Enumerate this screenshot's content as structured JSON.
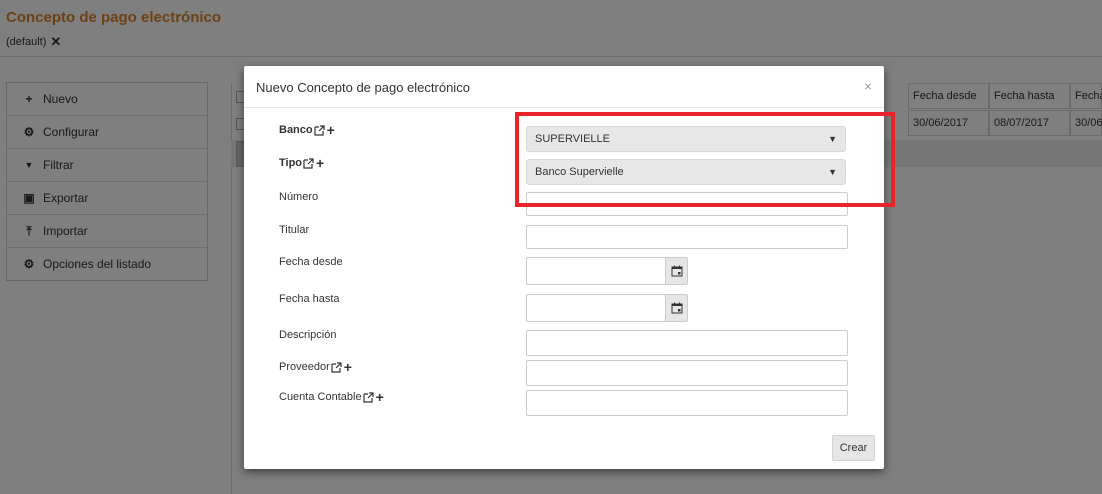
{
  "page": {
    "title": "Concepto de pago electrónico",
    "view_tab": "(default)",
    "view_tab_close": "✕"
  },
  "sidebar": {
    "items": [
      {
        "icon": "plus-icon",
        "glyph": "+",
        "label": "Nuevo"
      },
      {
        "icon": "gear-icon",
        "glyph": "⚙",
        "label": "Configurar"
      },
      {
        "icon": "filter-icon",
        "glyph": "▼",
        "label": "Filtrar"
      },
      {
        "icon": "excel-icon",
        "glyph": "▣",
        "label": "Exportar"
      },
      {
        "icon": "upload-icon",
        "glyph": "⤒",
        "label": "Importar"
      },
      {
        "icon": "gear-icon",
        "glyph": "⚙",
        "label": "Opciones del listado"
      }
    ]
  },
  "background_table": {
    "headers": [
      "Fecha desde",
      "Fecha hasta",
      "Fecha"
    ],
    "row": [
      "30/06/2017",
      "08/07/2017",
      "30/06"
    ]
  },
  "modal": {
    "title": "Nuevo Concepto de pago electrónico",
    "close": "×",
    "fields": {
      "banco": {
        "label": "Banco",
        "value": "SUPERVIELLE"
      },
      "tipo": {
        "label": "Tipo",
        "value": "Banco Supervielle"
      },
      "numero": {
        "label": "Número",
        "value": ""
      },
      "titular": {
        "label": "Titular",
        "value": ""
      },
      "fecha_desde": {
        "label": "Fecha desde",
        "value": ""
      },
      "fecha_hasta": {
        "label": "Fecha hasta",
        "value": ""
      },
      "descripcion": {
        "label": "Descripción",
        "value": ""
      },
      "proveedor": {
        "label": "Proveedor",
        "value": ""
      },
      "cuenta_contable": {
        "label": "Cuenta Contable",
        "value": ""
      }
    },
    "submit_label": "Crear"
  },
  "colors": {
    "title_orange": "#d9822b",
    "highlight_red": "#e8232a"
  }
}
